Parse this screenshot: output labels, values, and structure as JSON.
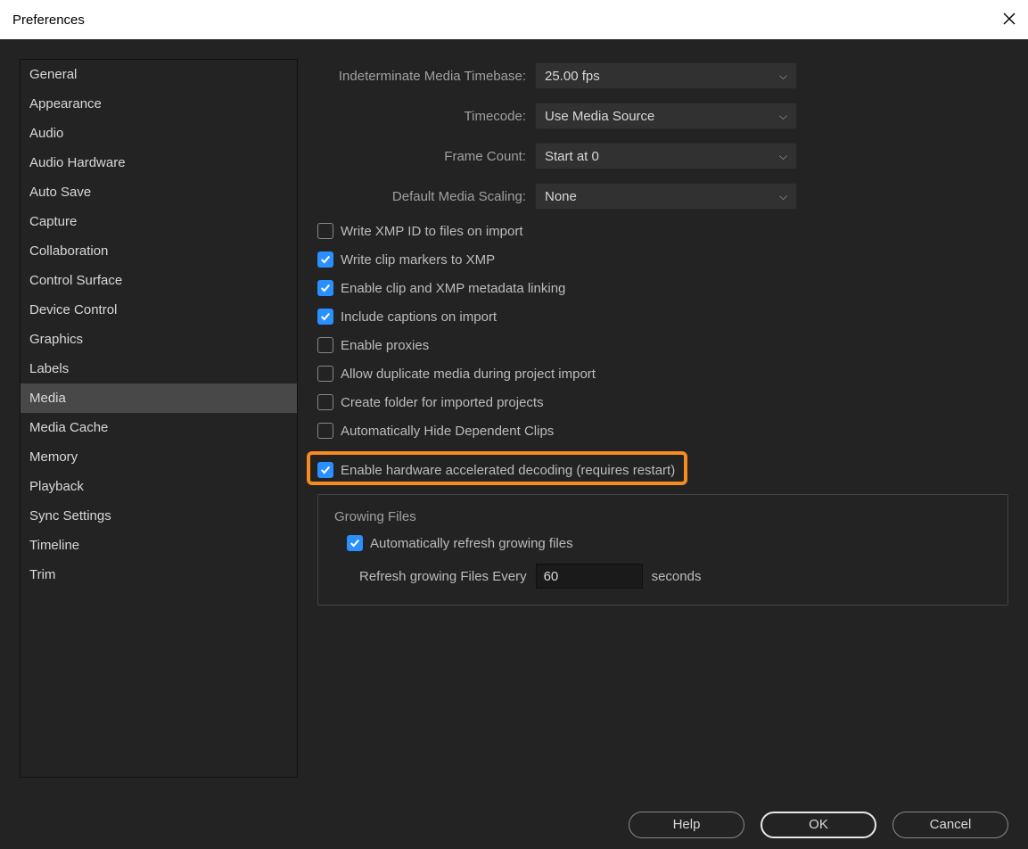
{
  "window": {
    "title": "Preferences"
  },
  "sidebar": {
    "items": [
      {
        "label": "General"
      },
      {
        "label": "Appearance"
      },
      {
        "label": "Audio"
      },
      {
        "label": "Audio Hardware"
      },
      {
        "label": "Auto Save"
      },
      {
        "label": "Capture"
      },
      {
        "label": "Collaboration"
      },
      {
        "label": "Control Surface"
      },
      {
        "label": "Device Control"
      },
      {
        "label": "Graphics"
      },
      {
        "label": "Labels"
      },
      {
        "label": "Media",
        "selected": true
      },
      {
        "label": "Media Cache"
      },
      {
        "label": "Memory"
      },
      {
        "label": "Playback"
      },
      {
        "label": "Sync Settings"
      },
      {
        "label": "Timeline"
      },
      {
        "label": "Trim"
      }
    ]
  },
  "dropdowns": {
    "timebase": {
      "label": "Indeterminate Media Timebase:",
      "value": "25.00 fps"
    },
    "timecode": {
      "label": "Timecode:",
      "value": "Use Media Source"
    },
    "frameCount": {
      "label": "Frame Count:",
      "value": "Start at 0"
    },
    "scaling": {
      "label": "Default Media Scaling:",
      "value": "None"
    }
  },
  "checks": [
    {
      "label": "Write XMP ID to files on import",
      "checked": false
    },
    {
      "label": "Write clip markers to XMP",
      "checked": true
    },
    {
      "label": "Enable clip and XMP metadata linking",
      "checked": true
    },
    {
      "label": "Include captions on import",
      "checked": true
    },
    {
      "label": "Enable proxies",
      "checked": false
    },
    {
      "label": "Allow duplicate media during project import",
      "checked": false
    },
    {
      "label": "Create folder for imported projects",
      "checked": false
    },
    {
      "label": "Automatically Hide Dependent Clips",
      "checked": false
    }
  ],
  "highlighted": {
    "label": "Enable hardware accelerated decoding (requires restart)",
    "checked": true
  },
  "growing": {
    "legend": "Growing Files",
    "autoRefresh": {
      "label": "Automatically refresh growing files",
      "checked": true
    },
    "refreshLabel": "Refresh growing Files Every",
    "refreshValue": "60",
    "refreshUnit": "seconds"
  },
  "buttons": {
    "help": "Help",
    "ok": "OK",
    "cancel": "Cancel"
  }
}
